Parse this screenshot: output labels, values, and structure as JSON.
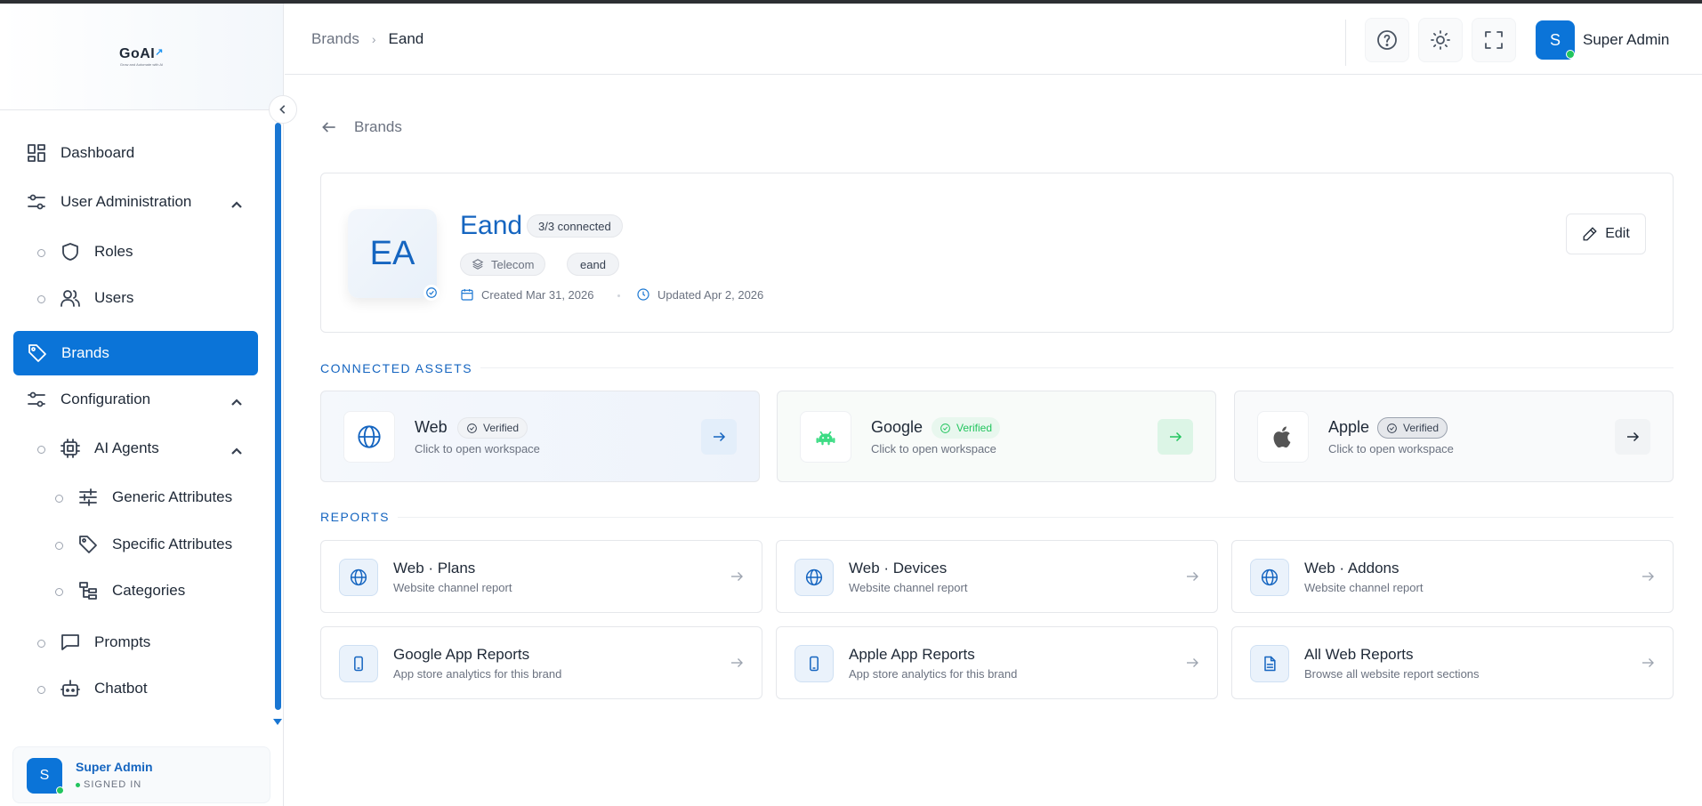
{
  "app": {
    "logo_text": "GoAI",
    "logo_tagline": "Grow and Automate with AI"
  },
  "sidebar": {
    "items": {
      "dashboard": "Dashboard",
      "user_admin": "User Administration",
      "roles": "Roles",
      "users": "Users",
      "brands": "Brands",
      "configuration": "Configuration",
      "ai_agents": "AI Agents",
      "generic_attributes": "Generic Attributes",
      "specific_attributes": "Specific Attributes",
      "categories": "Categories",
      "prompts": "Prompts",
      "chatbot": "Chatbot"
    },
    "user": {
      "initial": "S",
      "name": "Super Admin",
      "status": "SIGNED IN"
    }
  },
  "header": {
    "breadcrumb": [
      "Brands",
      "Eand"
    ],
    "user_initial": "S",
    "user_name": "Super Admin"
  },
  "main": {
    "back_label": "Brands",
    "brand": {
      "initials": "EA",
      "name": "Eand",
      "connected": "3/3 connected",
      "category": "Telecom",
      "slug": "eand",
      "created": "Created Mar 31, 2026",
      "updated": "Updated Apr 2, 2026",
      "edit_label": "Edit"
    },
    "connected_assets_title": "CONNECTED ASSETS",
    "assets": [
      {
        "name": "Web",
        "badge": "Verified",
        "sub": "Click to open workspace",
        "icon": "globe-icon"
      },
      {
        "name": "Google",
        "badge": "Verified",
        "sub": "Click to open workspace",
        "icon": "android-icon"
      },
      {
        "name": "Apple",
        "badge": "Verified",
        "sub": "Click to open workspace",
        "icon": "apple-icon"
      }
    ],
    "reports_title": "REPORTS",
    "reports": [
      {
        "title": "Web · Plans",
        "sub": "Website channel report",
        "icon": "globe-icon"
      },
      {
        "title": "Web · Devices",
        "sub": "Website channel report",
        "icon": "globe-icon"
      },
      {
        "title": "Web · Addons",
        "sub": "Website channel report",
        "icon": "globe-icon"
      },
      {
        "title": "Google App Reports",
        "sub": "App store analytics for this brand",
        "icon": "smartphone-icon"
      },
      {
        "title": "Apple App Reports",
        "sub": "App store analytics for this brand",
        "icon": "smartphone-icon"
      },
      {
        "title": "All Web Reports",
        "sub": "Browse all website report sections",
        "icon": "document-icon"
      }
    ]
  },
  "colors": {
    "accent": "#0b74d8",
    "brand_text": "#1565c0",
    "verified_green": "#22c55e"
  }
}
